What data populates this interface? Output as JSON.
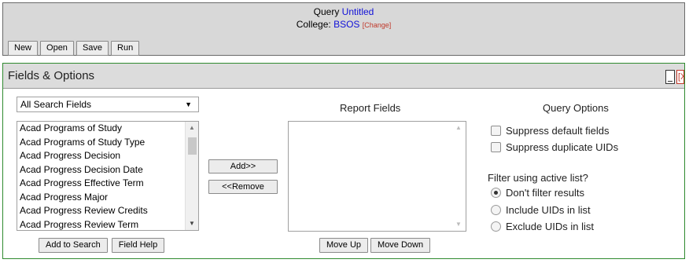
{
  "query": {
    "label": "Query",
    "name": "Untitled"
  },
  "college": {
    "label": "College:",
    "name": "BSOS",
    "change": "[Change]"
  },
  "toolbar": {
    "new": "New",
    "open": "Open",
    "save": "Save",
    "run": "Run"
  },
  "fields_panel": {
    "title": "Fields & Options"
  },
  "search_select": {
    "selected": "All Search Fields",
    "arrow": "▼"
  },
  "field_list": [
    "Acad Programs of Study",
    "Acad Programs of Study Type",
    "Acad Progress Decision",
    "Acad Progress Decision Date",
    "Acad Progress Effective Term",
    "Acad Progress Major",
    "Acad Progress Review Credits",
    "Acad Progress Review Term"
  ],
  "left_buttons": {
    "add_to_search": "Add to Search",
    "field_help": "Field Help"
  },
  "mid_buttons": {
    "add": "Add>>",
    "remove": "<<Remove"
  },
  "report_fields": {
    "heading": "Report Fields",
    "move_up": "Move Up",
    "move_down": "Move Down"
  },
  "query_options": {
    "heading": "Query Options",
    "suppress_default": "Suppress default fields",
    "suppress_duplicate": "Suppress duplicate UIDs",
    "filter_label": "Filter using active list?",
    "radio_dont_filter": "Don't filter results",
    "radio_include": "Include UIDs in list",
    "radio_exclude": "Exclude UIDs in list"
  },
  "colors": {
    "link": "#1010d8",
    "change": "#c0392b",
    "panel_border": "#2f8a2f",
    "header_bg": "#dcdcdc"
  }
}
